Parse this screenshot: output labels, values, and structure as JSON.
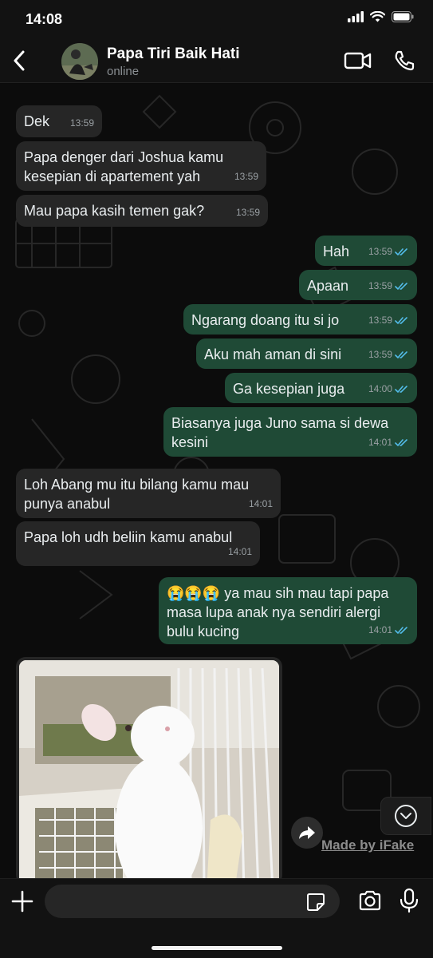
{
  "status_bar": {
    "time": "14:08",
    "icons": [
      "signal-icon",
      "wifi-icon",
      "battery-icon"
    ]
  },
  "header": {
    "contact_name": "Papa Tiri Baik Hati",
    "status": "online",
    "icons": [
      "back-arrow-icon",
      "video-call-icon",
      "phone-icon"
    ]
  },
  "messages": [
    {
      "dir": "in",
      "text": "Dek",
      "time": "13:59"
    },
    {
      "dir": "in",
      "text": "Papa denger dari Joshua kamu kesepian di apartement yah",
      "time": "13:59"
    },
    {
      "dir": "in",
      "text": "Mau papa kasih temen gak?",
      "time": "13:59"
    },
    {
      "dir": "out",
      "text": "Hah",
      "time": "13:59",
      "read": true
    },
    {
      "dir": "out",
      "text": "Apaan",
      "time": "13:59",
      "read": true
    },
    {
      "dir": "out",
      "text": "Ngarang doang itu si jo",
      "time": "13:59",
      "read": true
    },
    {
      "dir": "out",
      "text": "Aku mah aman di sini",
      "time": "13:59",
      "read": true
    },
    {
      "dir": "out",
      "text": "Ga kesepian juga",
      "time": "14:00",
      "read": true
    },
    {
      "dir": "out",
      "text": "Biasanya juga Juno sama si dewa kesini",
      "time": "14:01",
      "read": true
    },
    {
      "dir": "in",
      "text": "Loh Abang mu itu bilang kamu mau punya anabul",
      "time": "14:01"
    },
    {
      "dir": "in",
      "text": "Papa loh udh beliin kamu anabul",
      "time": "14:01"
    },
    {
      "dir": "out",
      "text": "😭😭😭 ya mau sih mau tapi papa masa lupa anak nya sendiri alergi bulu kucing",
      "time": "14:01",
      "read": true
    }
  ],
  "image_message": {
    "dir": "in",
    "subject": "white-rabbit-photo"
  },
  "watermark": "Made by iFake",
  "input_bar": {
    "placeholder": "",
    "icons": [
      "plus-icon",
      "sticker-icon",
      "camera-icon",
      "microphone-icon"
    ]
  },
  "colors": {
    "incoming_bubble": "#262626",
    "outgoing_bubble": "#1f4a36",
    "read_ticks": "#53bdeb",
    "background": "#0c0c0c"
  }
}
